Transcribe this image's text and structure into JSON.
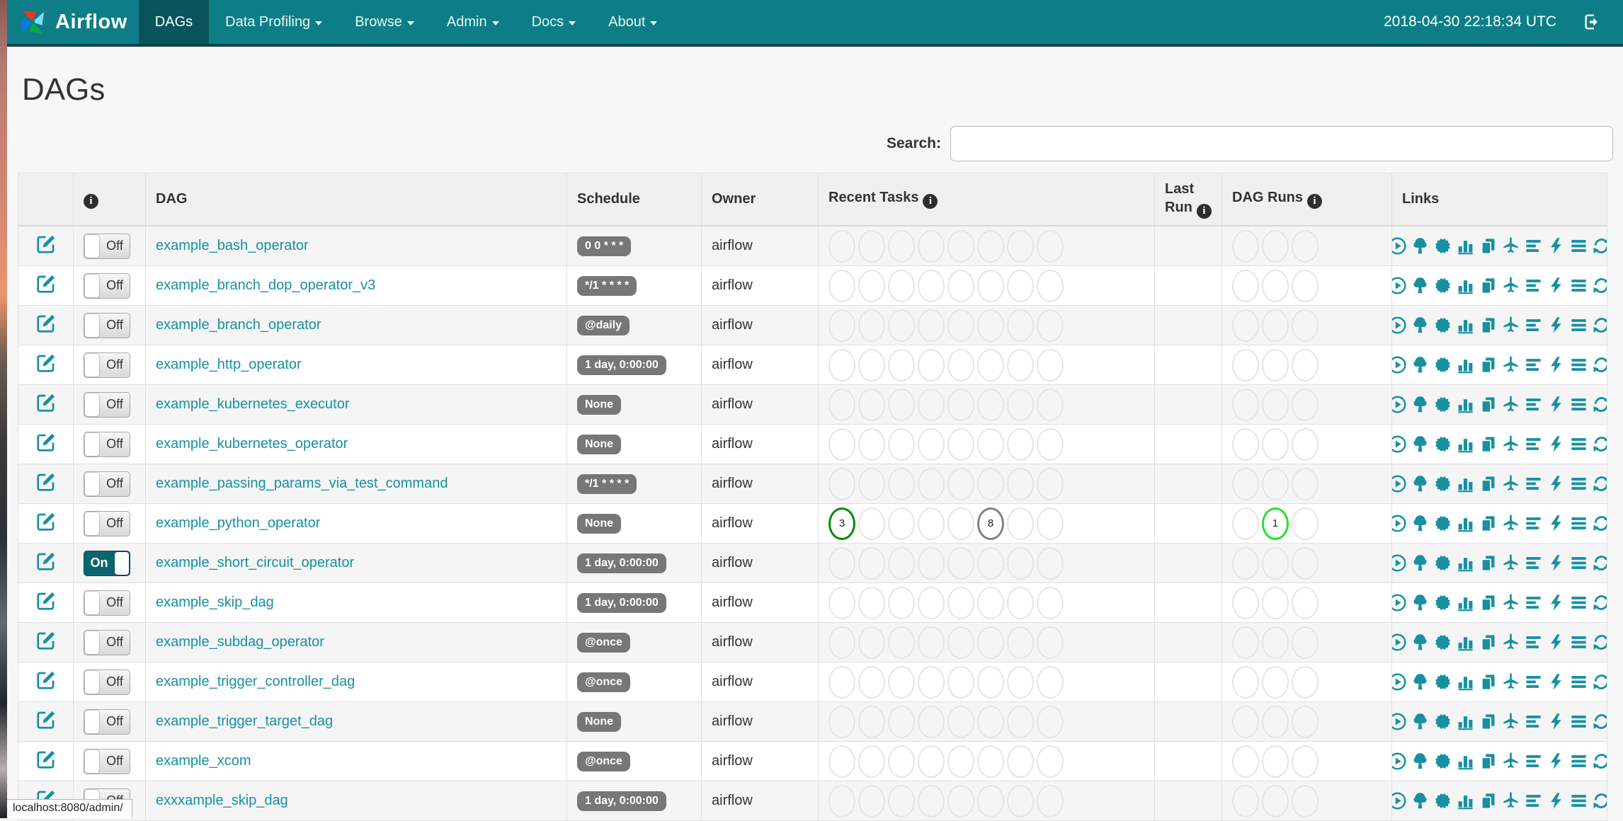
{
  "navbar": {
    "brand": "Airflow",
    "items": [
      {
        "label": "DAGs",
        "active": true,
        "caret": false
      },
      {
        "label": "Data Profiling",
        "active": false,
        "caret": true
      },
      {
        "label": "Browse",
        "active": false,
        "caret": true
      },
      {
        "label": "Admin",
        "active": false,
        "caret": true
      },
      {
        "label": "Docs",
        "active": false,
        "caret": true
      },
      {
        "label": "About",
        "active": false,
        "caret": true
      }
    ],
    "clock": "2018-04-30 22:18:34 UTC",
    "logout_icon": "sign-out-icon"
  },
  "page": {
    "title": "DAGs"
  },
  "search": {
    "label": "Search:",
    "value": "",
    "placeholder": ""
  },
  "colors": {
    "navbar_bg": "#0d7e87",
    "navbar_active_bg": "#09545c",
    "accent_link": "#1790a2",
    "badge_bg": "#777777",
    "success": "#078a07",
    "queued": "#838383",
    "running": "#2edd2e"
  },
  "table": {
    "headers": {
      "info_icon": "info-icon",
      "dag": "DAG",
      "schedule": "Schedule",
      "owner": "Owner",
      "recent_tasks": "Recent Tasks",
      "last_run_line1": "Last",
      "last_run_line2": "Run",
      "dag_runs": "DAG Runs",
      "links": "Links"
    },
    "recent_task_slots": 8,
    "dag_run_slots": 3,
    "links_icons": [
      {
        "name": "trigger-dag-icon",
        "svg": "svg-trigger"
      },
      {
        "name": "tree-view-icon",
        "svg": "svg-tree"
      },
      {
        "name": "graph-view-icon",
        "svg": "svg-graph"
      },
      {
        "name": "task-duration-icon",
        "svg": "svg-duration"
      },
      {
        "name": "task-tries-icon",
        "svg": "svg-tries"
      },
      {
        "name": "landing-times-icon",
        "svg": "svg-plane"
      },
      {
        "name": "gantt-view-icon",
        "svg": "svg-gantt"
      },
      {
        "name": "code-view-icon",
        "svg": "svg-bolt"
      },
      {
        "name": "logs-icon",
        "svg": "svg-logs"
      },
      {
        "name": "refresh-icon",
        "svg": "svg-refresh"
      }
    ],
    "rows": [
      {
        "name": "example_bash_operator",
        "toggle": "Off",
        "schedule": "0 0 * * *",
        "owner": "airflow",
        "recent_tasks": [],
        "dag_runs": []
      },
      {
        "name": "example_branch_dop_operator_v3",
        "toggle": "Off",
        "schedule": "*/1 * * * *",
        "owner": "airflow",
        "recent_tasks": [],
        "dag_runs": []
      },
      {
        "name": "example_branch_operator",
        "toggle": "Off",
        "schedule": "@daily",
        "owner": "airflow",
        "recent_tasks": [],
        "dag_runs": []
      },
      {
        "name": "example_http_operator",
        "toggle": "Off",
        "schedule": "1 day, 0:00:00",
        "owner": "airflow",
        "recent_tasks": [],
        "dag_runs": []
      },
      {
        "name": "example_kubernetes_executor",
        "toggle": "Off",
        "schedule": "None",
        "owner": "airflow",
        "recent_tasks": [],
        "dag_runs": []
      },
      {
        "name": "example_kubernetes_operator",
        "toggle": "Off",
        "schedule": "None",
        "owner": "airflow",
        "recent_tasks": [],
        "dag_runs": []
      },
      {
        "name": "example_passing_params_via_test_command",
        "toggle": "Off",
        "schedule": "*/1 * * * *",
        "owner": "airflow",
        "recent_tasks": [],
        "dag_runs": []
      },
      {
        "name": "example_python_operator",
        "toggle": "Off",
        "schedule": "None",
        "owner": "airflow",
        "recent_tasks": [
          {
            "slot": 0,
            "count": "3",
            "state": "success"
          },
          {
            "slot": 5,
            "count": "8",
            "state": "queued"
          }
        ],
        "dag_runs": [
          {
            "slot": 1,
            "count": "1",
            "state": "running"
          }
        ]
      },
      {
        "name": "example_short_circuit_operator",
        "toggle": "On",
        "schedule": "1 day, 0:00:00",
        "owner": "airflow",
        "recent_tasks": [],
        "dag_runs": []
      },
      {
        "name": "example_skip_dag",
        "toggle": "Off",
        "schedule": "1 day, 0:00:00",
        "owner": "airflow",
        "recent_tasks": [],
        "dag_runs": []
      },
      {
        "name": "example_subdag_operator",
        "toggle": "Off",
        "schedule": "@once",
        "owner": "airflow",
        "recent_tasks": [],
        "dag_runs": []
      },
      {
        "name": "example_trigger_controller_dag",
        "toggle": "Off",
        "schedule": "@once",
        "owner": "airflow",
        "recent_tasks": [],
        "dag_runs": []
      },
      {
        "name": "example_trigger_target_dag",
        "toggle": "Off",
        "schedule": "None",
        "owner": "airflow",
        "recent_tasks": [],
        "dag_runs": []
      },
      {
        "name": "example_xcom",
        "toggle": "Off",
        "schedule": "@once",
        "owner": "airflow",
        "recent_tasks": [],
        "dag_runs": []
      },
      {
        "name": "exxxample_skip_dag",
        "toggle": "Off",
        "schedule": "1 day, 0:00:00",
        "owner": "airflow",
        "recent_tasks": [],
        "dag_runs": []
      }
    ]
  },
  "status_bar": {
    "url": "localhost:8080/admin/"
  }
}
